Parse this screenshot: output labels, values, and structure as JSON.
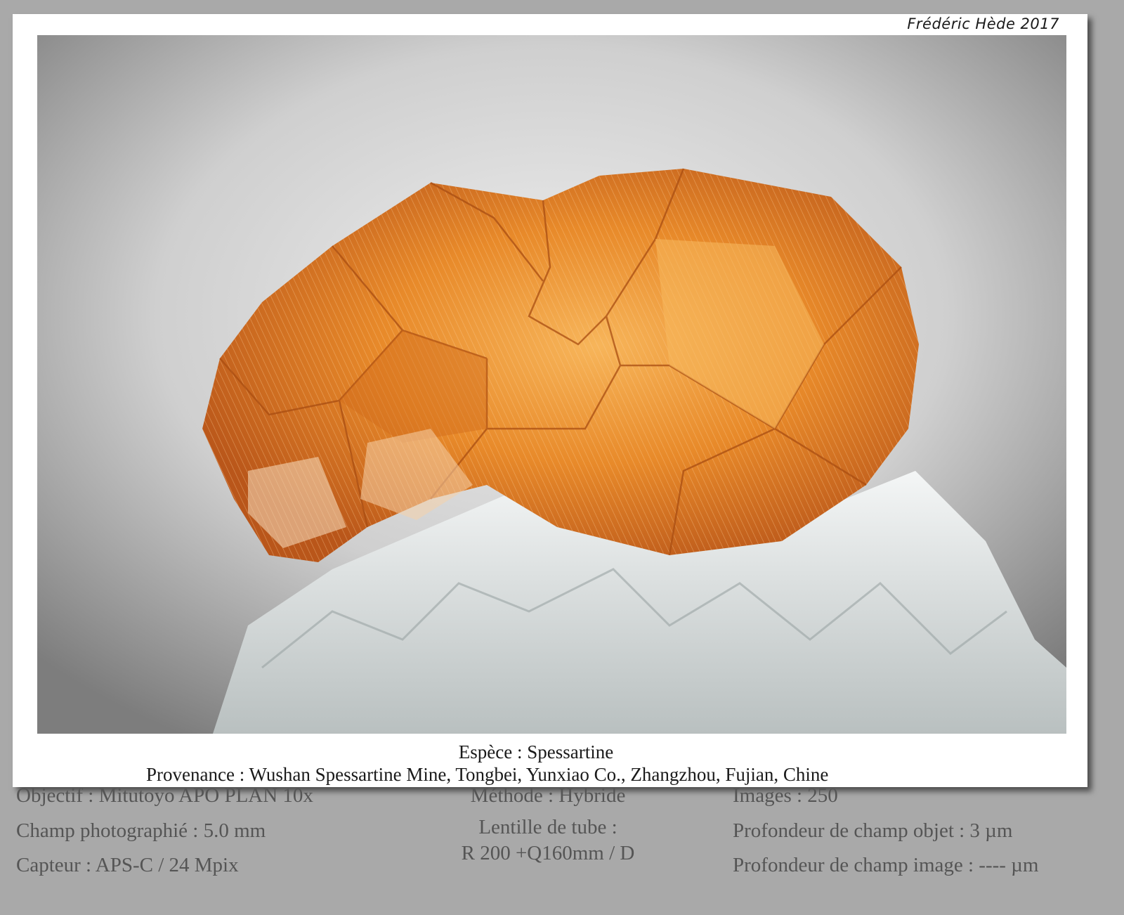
{
  "signature": "Frédéric Hède 2017",
  "species": "Espèce : Spessartine",
  "origin": "Provenance : Wushan Spessartine Mine, Tongbei, Yunxiao Co., Zhangzhou, Fujian, Chine",
  "metadata": {
    "col1": [
      "Objectif : Mitutoyo APO PLAN 10x",
      "Champ photographié : 5.0 mm",
      "Capteur : APS-C / 24 Mpix"
    ],
    "col2": {
      "method": "Méthode : Hybride",
      "tube_line1": "Lentille de tube :",
      "tube_line2": "R 200 +Q160mm / D"
    },
    "col3": [
      "Images : 250",
      "Profondeur de champ objet : 3 µm",
      "Profondeur de champ image : ---- µm"
    ]
  },
  "colors": {
    "crystal": "#e07a1c",
    "crystal_highlight": "#f6b35a",
    "matrix": "#e8ecec",
    "background_outer": "#a9a9a9"
  }
}
